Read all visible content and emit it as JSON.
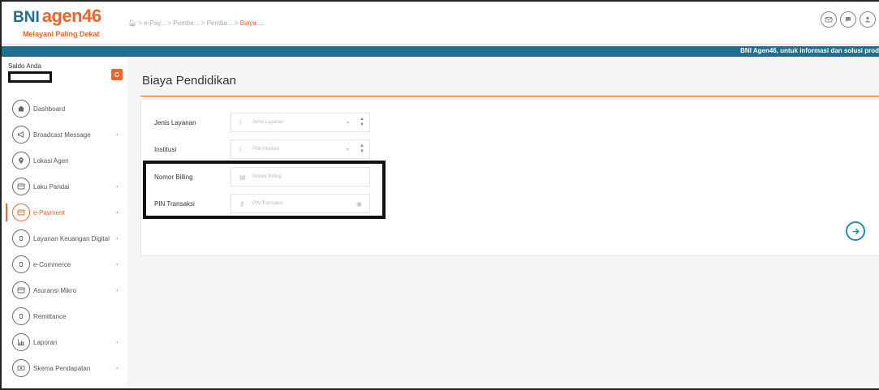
{
  "header": {
    "logo_bni": "BNI",
    "logo_agen": "agen46",
    "logo_tagline": "Melayani Paling Dekat",
    "breadcrumb": [
      {
        "label": "e-Pay...",
        "active": false
      },
      {
        "label": "Pembe...",
        "active": false
      },
      {
        "label": "Pemba...",
        "active": false
      },
      {
        "label": "Biaya ...",
        "active": true
      }
    ],
    "icons": [
      "mail-icon",
      "chat-icon",
      "user-icon"
    ]
  },
  "strip": {
    "text": "BNI Agen46, untuk informasi dan solusi prod"
  },
  "sidebar": {
    "saldo_label": "Saldo Anda",
    "items": [
      {
        "label": "Dashboard",
        "icon": "home-icon",
        "chevron": false,
        "active": false
      },
      {
        "label": "Broadcast Message",
        "icon": "megaphone-icon",
        "chevron": true,
        "active": false
      },
      {
        "label": "Lokasi Agen",
        "icon": "location-icon",
        "chevron": false,
        "active": false
      },
      {
        "label": "Laku Pandai",
        "icon": "card-icon",
        "chevron": true,
        "active": false
      },
      {
        "label": "e-Payment",
        "icon": "card-icon",
        "chevron": true,
        "active": true
      },
      {
        "label": "Layanan Keuangan Digital",
        "icon": "coin-icon",
        "chevron": true,
        "active": false
      },
      {
        "label": "e-Commerce",
        "icon": "coin-icon",
        "chevron": true,
        "active": false
      },
      {
        "label": "Asuransi Mikro",
        "icon": "card-icon",
        "chevron": true,
        "active": false
      },
      {
        "label": "Remittance",
        "icon": "coin-icon",
        "chevron": false,
        "active": false
      },
      {
        "label": "Laporan",
        "icon": "chart-icon",
        "chevron": true,
        "active": false
      },
      {
        "label": "Skema Pendapatan",
        "icon": "money-icon",
        "chevron": true,
        "active": false
      }
    ],
    "chevron_char": "›"
  },
  "main": {
    "title": "Biaya Pendidikan",
    "form": {
      "jenis_layanan": {
        "label": "Jenis Layanan",
        "placeholder": "Jenis Layanan"
      },
      "institusi": {
        "label": "Institusi",
        "placeholder": "Pilih Institusi"
      },
      "nomor_billing": {
        "label": "Nomor Billing",
        "placeholder": "Nomor Billing"
      },
      "pin_transaksi": {
        "label": "PIN Transaksi",
        "placeholder": "PIN Transaksi"
      }
    }
  },
  "colors": {
    "brand_orange": "#e8652b",
    "brand_blue": "#1f6f8f",
    "accent_teal": "#1f8fb0"
  }
}
